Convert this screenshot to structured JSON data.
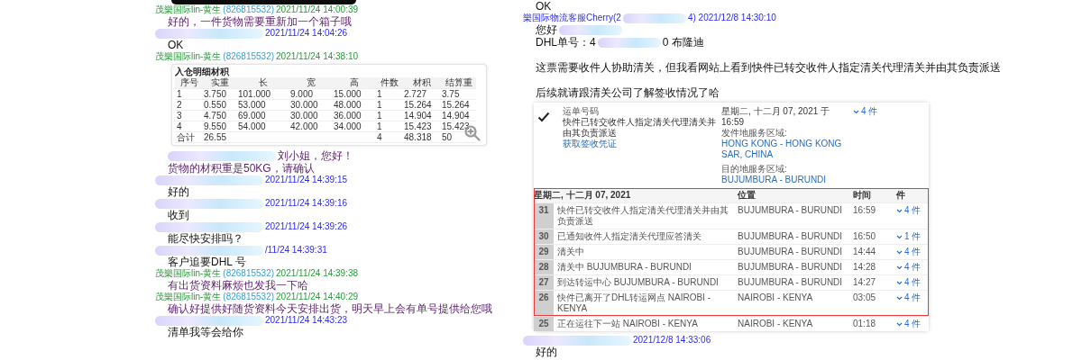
{
  "left": {
    "entries": [
      {
        "kind": "image_edge"
      },
      {
        "kind": "header",
        "color": "#2a9a3a",
        "segments": [
          {
            "kind": "name",
            "text": "茂樂国际lin-黄生"
          },
          {
            "kind": "id",
            "text": "(826815532)"
          },
          {
            "kind": "time",
            "text": "2021/11/24 14:00:39"
          }
        ]
      },
      {
        "kind": "text",
        "from_staff": true,
        "segments": [
          {
            "kind": "text",
            "text": "好的，一件货物需要重新加一个箱子哦"
          }
        ]
      },
      {
        "kind": "header",
        "color": "#2b2bef",
        "segments": [
          {
            "kind": "blur"
          },
          {
            "kind": "time",
            "text": "2021/11/24 14:04:26"
          }
        ]
      },
      {
        "kind": "text",
        "from_staff": false,
        "segments": [
          {
            "kind": "text",
            "text": "OK"
          }
        ]
      },
      {
        "kind": "header",
        "color": "#2a9a3a",
        "segments": [
          {
            "kind": "name",
            "text": "茂樂国际lin-黄生"
          },
          {
            "kind": "id",
            "text": "(826815532)"
          },
          {
            "kind": "time",
            "text": "2021/11/24 14:38:10"
          }
        ]
      },
      {
        "kind": "table_image",
        "title": "入仓明细材积",
        "columns": [
          "序号",
          "实重",
          "长",
          "宽",
          "高",
          "件数",
          "材积",
          "结算重"
        ],
        "rows": [
          [
            "1",
            "3.750",
            "101.000",
            "9.000",
            "15.000",
            "1",
            "2.727",
            "3.75"
          ],
          [
            "2",
            "0.550",
            "53.000",
            "30.000",
            "48.000",
            "1",
            "15.264",
            "15.264"
          ],
          [
            "3",
            "4.750",
            "69.000",
            "30.000",
            "36.000",
            "1",
            "14.904",
            "14.904"
          ],
          [
            "4",
            "9.550",
            "54.000",
            "42.000",
            "34.000",
            "1",
            "15.423",
            "15.423"
          ],
          [
            "合计",
            "26.55",
            null,
            null,
            null,
            "4",
            "48.318",
            "50"
          ]
        ]
      },
      {
        "kind": "text",
        "from_staff": true,
        "segments": [
          {
            "kind": "blur"
          },
          {
            "kind": "text",
            "text": "刘小姐，您好！"
          }
        ]
      },
      {
        "kind": "text",
        "from_staff": true,
        "segments": [
          {
            "kind": "text",
            "text": "货物的材积重是50KG，请确认"
          }
        ]
      },
      {
        "kind": "header",
        "color": "#2b2bef",
        "segments": [
          {
            "kind": "blur"
          },
          {
            "kind": "time",
            "text": "2021/11/24 14:39:15"
          }
        ]
      },
      {
        "kind": "text",
        "from_staff": false,
        "segments": [
          {
            "kind": "text",
            "text": "好的"
          }
        ]
      },
      {
        "kind": "header",
        "color": "#2b2bef",
        "segments": [
          {
            "kind": "blur"
          },
          {
            "kind": "time",
            "text": "2021/11/24 14:39:16"
          }
        ]
      },
      {
        "kind": "text",
        "from_staff": false,
        "segments": [
          {
            "kind": "text",
            "text": "收到"
          }
        ]
      },
      {
        "kind": "header",
        "color": "#2b2bef",
        "segments": [
          {
            "kind": "blur"
          },
          {
            "kind": "time",
            "text": "2021/11/24 14:39:26"
          }
        ]
      },
      {
        "kind": "text",
        "from_staff": false,
        "segments": [
          {
            "kind": "text",
            "text": "能尽快安排吗？"
          }
        ]
      },
      {
        "kind": "header",
        "color": "#2b2bef",
        "segments": [
          {
            "kind": "blur"
          },
          {
            "kind": "time",
            "text": "/11/24 14:39:31"
          }
        ]
      },
      {
        "kind": "text",
        "from_staff": false,
        "segments": [
          {
            "kind": "text",
            "text": "客户追要DHL 号"
          }
        ]
      },
      {
        "kind": "header",
        "color": "#2a9a3a",
        "segments": [
          {
            "kind": "name",
            "text": "茂樂国际lin-黄生"
          },
          {
            "kind": "id",
            "text": "(826815532)"
          },
          {
            "kind": "time",
            "text": "2021/11/24 14:39:38"
          }
        ]
      },
      {
        "kind": "text",
        "from_staff": true,
        "segments": [
          {
            "kind": "text",
            "text": "有出货资料麻烦也发我一下哈"
          }
        ]
      },
      {
        "kind": "header",
        "color": "#2a9a3a",
        "segments": [
          {
            "kind": "name",
            "text": "茂樂国际lin-黄生"
          },
          {
            "kind": "id",
            "text": "(826815532)"
          },
          {
            "kind": "time",
            "text": "2021/11/24 14:40:29"
          }
        ]
      },
      {
        "kind": "text",
        "from_staff": true,
        "segments": [
          {
            "kind": "text",
            "text": "确认好提供好随货资料今天安排出货，明天早上会有单号提供给您哦"
          }
        ]
      },
      {
        "kind": "header",
        "color": "#2b2bef",
        "segments": [
          {
            "kind": "blur"
          },
          {
            "kind": "time",
            "text": "2021/11/24 14:43:23"
          }
        ]
      },
      {
        "kind": "text",
        "from_staff": false,
        "segments": [
          {
            "kind": "text",
            "text": "清单我等会给你"
          }
        ]
      }
    ]
  },
  "right": {
    "entries": [
      {
        "kind": "text",
        "from_staff": false,
        "segments": [
          {
            "kind": "text",
            "text": "OK"
          }
        ]
      },
      {
        "kind": "header",
        "color": "#2b2bef",
        "segments": [
          {
            "kind": "name",
            "text": "樂国际物流客服Cherry(2"
          },
          {
            "kind": "blur"
          },
          {
            "kind": "time",
            "text": "4) 2021/12/8 14:30:10"
          }
        ]
      },
      {
        "kind": "text",
        "from_staff": false,
        "segments": [
          {
            "kind": "text",
            "text": "您好"
          },
          {
            "kind": "blur"
          }
        ]
      },
      {
        "kind": "text",
        "from_staff": false,
        "segments": [
          {
            "kind": "text",
            "text": "DHL单号：4"
          },
          {
            "kind": "blur"
          },
          {
            "kind": "text",
            "text": "0  布隆迪"
          }
        ]
      },
      {
        "kind": "gap"
      },
      {
        "kind": "text",
        "from_staff": false,
        "segments": [
          {
            "kind": "text",
            "text": "这票需要收件人协助清关，但我看网站上看到快件已转交收件人指定清关代理清关并由其负责派送"
          }
        ]
      },
      {
        "kind": "gap"
      },
      {
        "kind": "text",
        "from_staff": false,
        "segments": [
          {
            "kind": "text",
            "text": "后续就请跟清关公司了解签收情况了哈"
          }
        ]
      },
      {
        "kind": "tracking_image",
        "summary": {
          "waybill_label": "运单号码",
          "status": "快件已转交收件人指定清关代理清关并由其负责派送",
          "link": "获取签收凭证",
          "date": "星期二, 十二月 07, 2021 于 16:59",
          "origin_label": "发件地服务区域:",
          "origin": "HONG KONG - HONG KONG SAR, CHINA",
          "destination_label": "目的地服务区域:",
          "destination": "BUJUMBURA - BURUNDI",
          "pieces": "4 件"
        },
        "columns": [
          "星期二, 十二月 07, 2021",
          "位置",
          "时间",
          "件"
        ],
        "rows": [
          {
            "number": "31",
            "event": "快件已转交收件人指定清关代理清关并由其负责派送",
            "location": "BUJUMBURA - BURUNDI",
            "time": "16:59",
            "pieces": "4 件",
            "highlighted": true
          },
          {
            "number": "30",
            "event": "已通知收件人指定清关代理应答清关",
            "location": "BUJUMBURA - BURUNDI",
            "time": "16:50",
            "pieces": "1 件",
            "highlighted": true
          },
          {
            "number": "29",
            "event": "清关中",
            "location": "BUJUMBURA - BURUNDI",
            "time": "14:44",
            "pieces": "4 件",
            "highlighted": true
          },
          {
            "number": "28",
            "event": "清关中 BUJUMBURA - BURUNDI",
            "location": "BUJUMBURA - BURUNDI",
            "time": "14:28",
            "pieces": "4 件",
            "highlighted": true
          },
          {
            "number": "27",
            "event": "到达转运中心 BUJUMBURA - BURUNDI",
            "location": "BUJUMBURA - BURUNDI",
            "time": "14:27",
            "pieces": "4 件",
            "highlighted": true
          },
          {
            "number": "26",
            "event": "快件已离开了DHL转运网点 NAIROBI - KENYA",
            "location": "NAIROBI - KENYA",
            "time": "03:05",
            "pieces": "4 件",
            "highlighted": true
          },
          {
            "number": "25",
            "event": "正在运往下一站 NAIROBI - KENYA",
            "location": "NAIROBI - KENYA",
            "time": "01:18",
            "pieces": "4 件",
            "highlighted": false
          }
        ]
      },
      {
        "kind": "header",
        "color": "#2b2bef",
        "segments": [
          {
            "kind": "blur"
          },
          {
            "kind": "time",
            "text": "2021/12/8 14:33:06"
          }
        ]
      },
      {
        "kind": "text",
        "from_staff": false,
        "segments": [
          {
            "kind": "text",
            "text": "好的"
          }
        ]
      }
    ]
  }
}
